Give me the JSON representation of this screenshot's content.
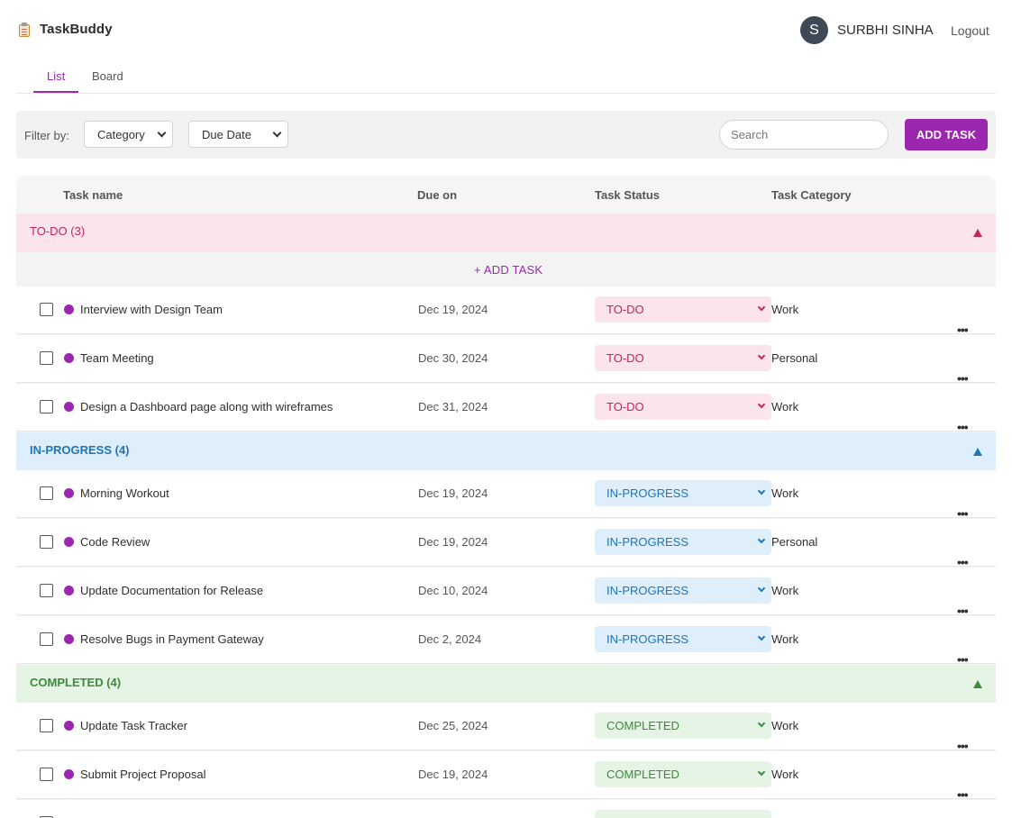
{
  "app": {
    "name": "TaskBuddy",
    "logo_icon": "clipboard-icon"
  },
  "user": {
    "initial": "S",
    "name": "SURBHI SINHA",
    "logout_label": "Logout"
  },
  "tabs": [
    {
      "label": "List",
      "active": true
    },
    {
      "label": "Board",
      "active": false
    }
  ],
  "filters": {
    "label": "Filter by:",
    "category": {
      "selected": "Category"
    },
    "due_date": {
      "selected": "Due Date"
    },
    "search_placeholder": "Search",
    "add_task_label": "ADD TASK"
  },
  "columns": [
    "Task name",
    "Due on",
    "Task Status",
    "Task Category"
  ],
  "add_task_inline_label": "+ ADD TASK",
  "groups": [
    {
      "title": "TO-DO (3)",
      "color": "#c3245a",
      "background": "#fbe4ec",
      "tasks": [
        {
          "name": "Interview with Design Team",
          "due": "Dec 19, 2024",
          "status": "TO-DO",
          "category": "Work"
        },
        {
          "name": "Team Meeting",
          "due": "Dec 30, 2024",
          "status": "TO-DO",
          "category": "Personal"
        },
        {
          "name": "Design a Dashboard page along with wireframes",
          "due": "Dec 31, 2024",
          "status": "TO-DO",
          "category": "Work"
        }
      ]
    },
    {
      "title": "IN-PROGRESS (4)",
      "color": "#1e75b8",
      "background": "#dfeefb",
      "tasks": [
        {
          "name": "Morning Workout",
          "due": "Dec 19, 2024",
          "status": "IN-PROGRESS",
          "category": "Work"
        },
        {
          "name": "Code Review",
          "due": "Dec 19, 2024",
          "status": "IN-PROGRESS",
          "category": "Personal"
        },
        {
          "name": "Update Documentation for Release",
          "due": "Dec 10, 2024",
          "status": "IN-PROGRESS",
          "category": "Work"
        },
        {
          "name": "Resolve Bugs in Payment Gateway",
          "due": "Dec 2, 2024",
          "status": "IN-PROGRESS",
          "category": "Work"
        }
      ]
    },
    {
      "title": "COMPLETED (4)",
      "color": "#3c8a3c",
      "background": "#e5f4e5",
      "tasks": [
        {
          "name": "Update Task Tracker",
          "due": "Dec 25, 2024",
          "status": "COMPLETED",
          "category": "Work"
        },
        {
          "name": "Submit Project Proposal",
          "due": "Dec 19, 2024",
          "status": "COMPLETED",
          "category": "Work"
        }
      ]
    }
  ],
  "more_icon": "more-horizontal-icon",
  "accent_color": "#9b27af"
}
